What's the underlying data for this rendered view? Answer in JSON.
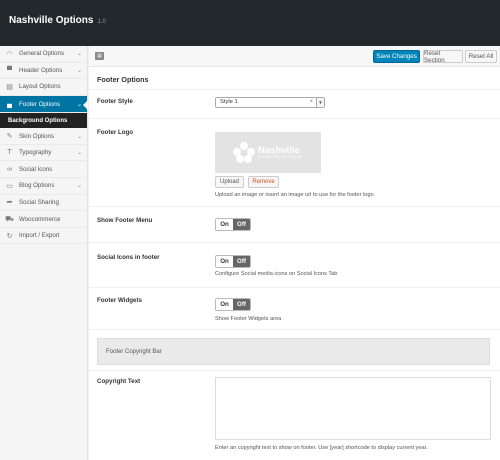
{
  "app": {
    "title": "Nashville Options",
    "version": "1.0"
  },
  "sidebar": {
    "items": [
      {
        "label": "General Options",
        "icon": "speedometer-icon",
        "glyph": "◠",
        "chevron": true
      },
      {
        "label": "Header Options",
        "icon": "header-icon",
        "glyph": "▀",
        "chevron": true
      },
      {
        "label": "Layout Options",
        "icon": "layout-icon",
        "glyph": "▤",
        "chevron": false
      },
      {
        "label": "Footer Options",
        "icon": "footer-icon",
        "glyph": "▄",
        "chevron": true,
        "active": true
      },
      {
        "label": "Background Options",
        "sub": true
      },
      {
        "label": "Skin Options",
        "icon": "brush-icon",
        "glyph": "✎",
        "chevron": true
      },
      {
        "label": "Typography",
        "icon": "typography-icon",
        "glyph": "T",
        "chevron": true
      },
      {
        "label": "Social Icons",
        "icon": "link-icon",
        "glyph": "∞",
        "chevron": false
      },
      {
        "label": "Blog Options",
        "icon": "blog-icon",
        "glyph": "▭",
        "chevron": true
      },
      {
        "label": "Social Sharing",
        "icon": "share-icon",
        "glyph": "➦",
        "chevron": false
      },
      {
        "label": "Woocommerce",
        "icon": "cart-icon",
        "glyph": "⛟",
        "chevron": false
      },
      {
        "label": "Import / Export",
        "icon": "refresh-icon",
        "glyph": "↻",
        "chevron": false
      }
    ]
  },
  "toolbar": {
    "expand_glyph": "▤",
    "save_label": "Save Changes",
    "reset_section_label": "Reset Section",
    "reset_all_label": "Reset All"
  },
  "main": {
    "section_title": "Footer Options",
    "footer_style": {
      "label": "Footer Style",
      "value": "Style 1",
      "clear": "×",
      "arrow": "▼"
    },
    "footer_logo": {
      "label": "Footer Logo",
      "logo_text": "Nashville",
      "logo_sub": "WORDPRESS THEME",
      "upload_label": "Upload",
      "remove_label": "Remove",
      "description": "Upload an image or insert an image url to use for the footer logo."
    },
    "show_footer_menu": {
      "label": "Show Footer Menu",
      "on": "On",
      "off": "Off"
    },
    "social_icons": {
      "label": "Social Icons in footer",
      "on": "On",
      "off": "Off",
      "description": "Configure Social media icons on Social Icons Tab"
    },
    "footer_widgets": {
      "label": "Footer Widgets",
      "on": "On",
      "off": "Off",
      "description": "Show Footer Widgets area"
    },
    "copyright_bar": {
      "label": "Footer Copyright Bar"
    },
    "copyright_text": {
      "label": "Copyright Text",
      "value": "",
      "description": "Enter an copyright text to show on footer. Use [year] shortcode to display current year."
    }
  },
  "colors": {
    "accent": "#0074a2",
    "save_button": "#0085ba",
    "topbar": "#23282d",
    "toggle_off": "#666666"
  }
}
